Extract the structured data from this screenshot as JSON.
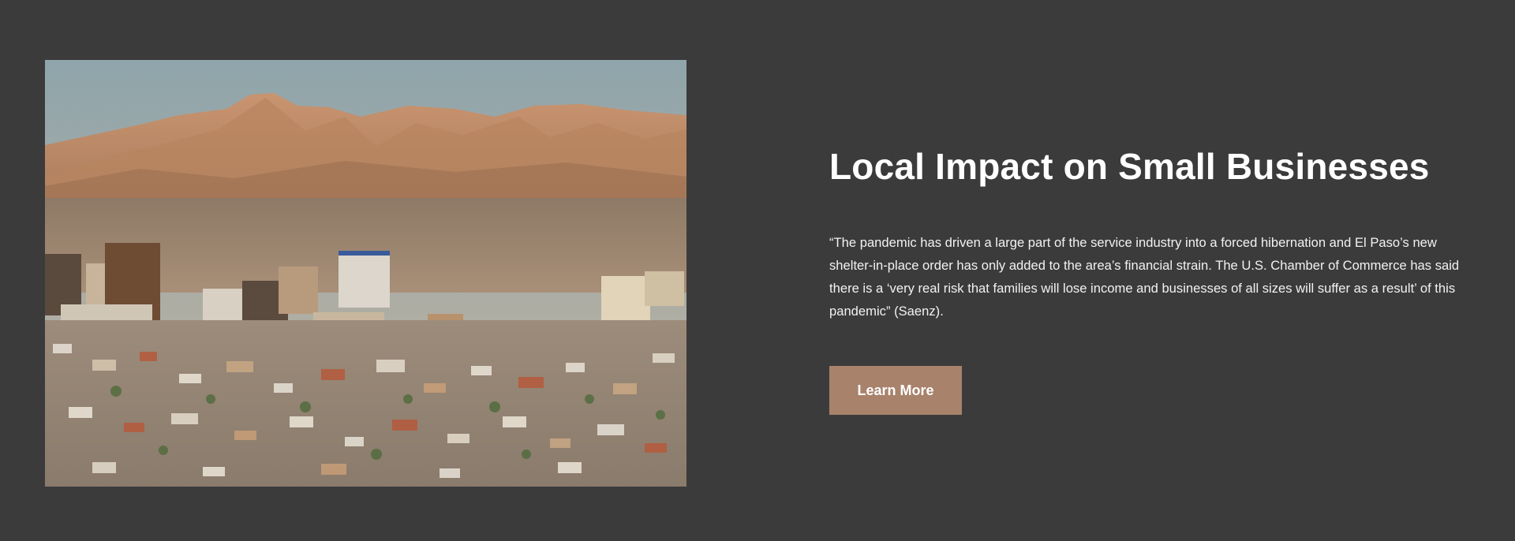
{
  "image": {
    "alt": "",
    "icon": "city-skyline-photo"
  },
  "section": {
    "title": "Local Impact on Small Businesses",
    "quote": "“The pandemic has driven a large part of the service industry into a forced hibernation and El Paso’s new shelter-in-place order has only added to the area’s financial strain. The U.S. Chamber of Commerce has said there is a ‘very real risk that families will lose income and businesses of all sizes will suffer as a result’ of this pandemic” (Saenz).",
    "cta_label": "Learn More"
  },
  "colors": {
    "background": "#3b3b3b",
    "accent": "#a8826b",
    "text": "#ffffff"
  }
}
